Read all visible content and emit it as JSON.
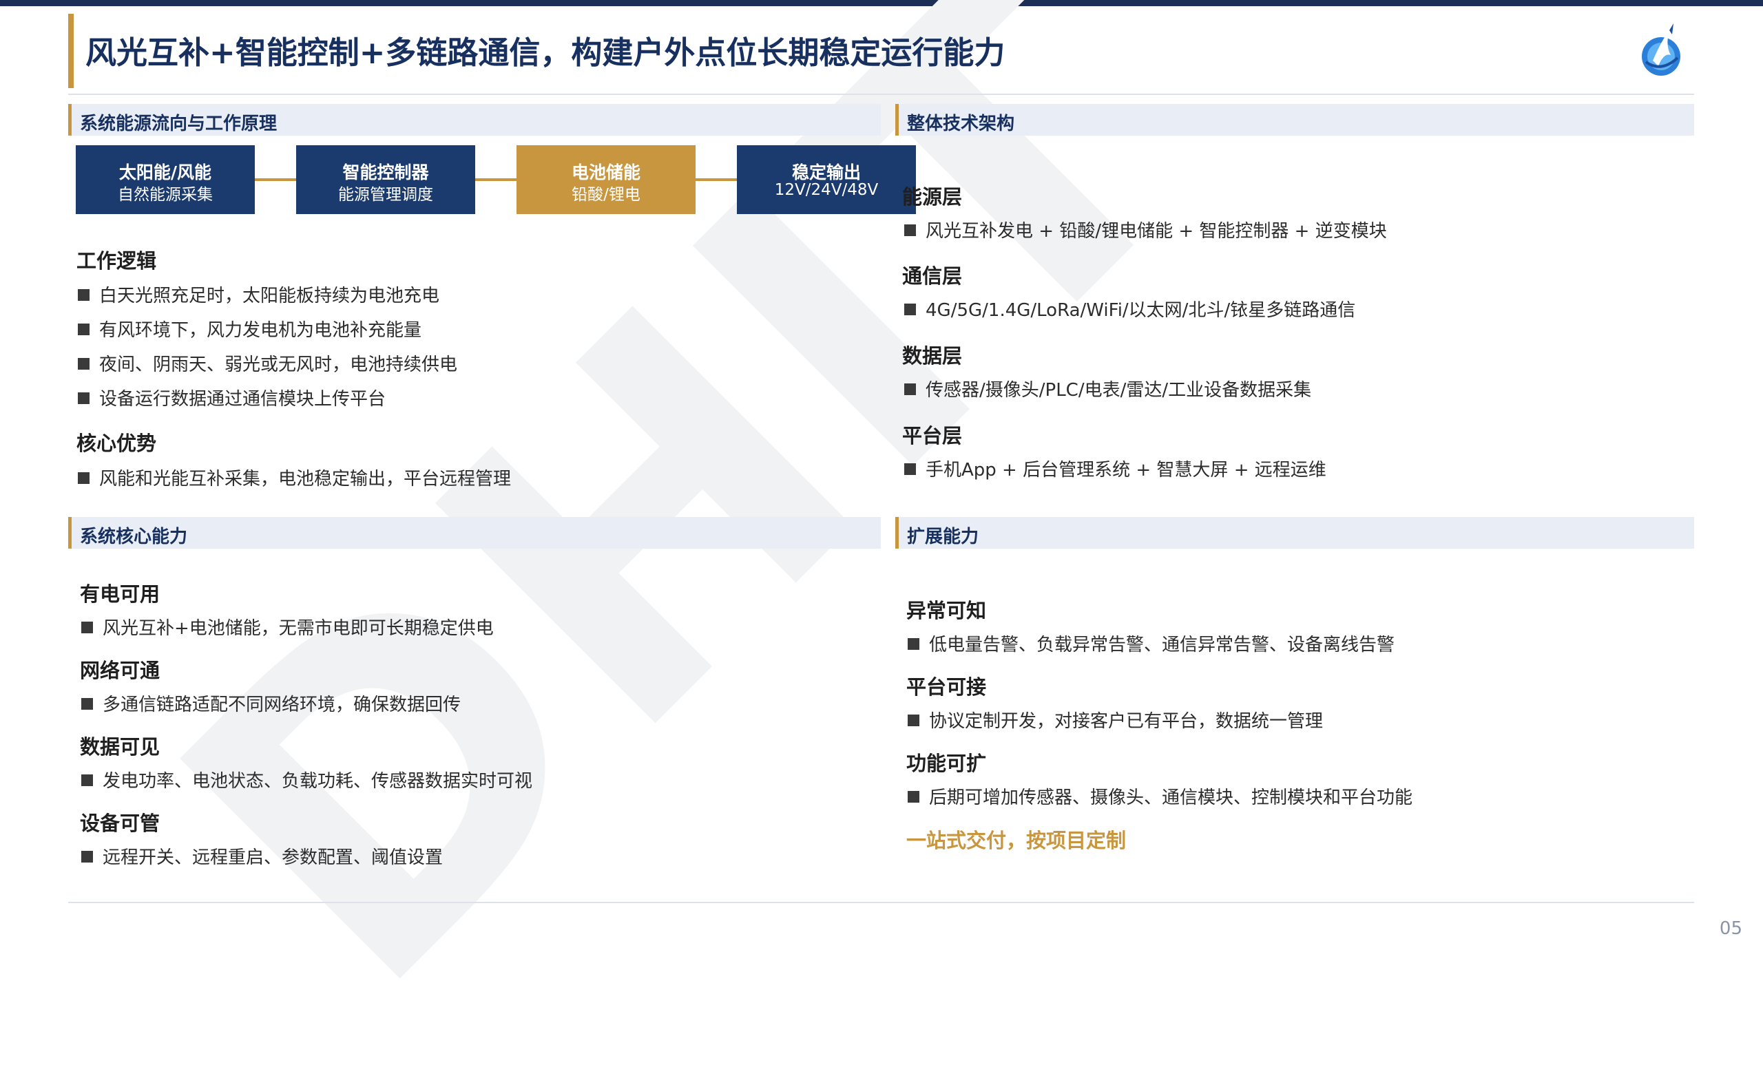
{
  "header": {
    "title": "风光互补+智能控制+多链路通信，构建户外点位长期稳定运行能力",
    "logo_icon": "company-logo-icon",
    "accent_color": "#c8963e",
    "brand_color": "#17305f"
  },
  "watermark": {
    "text": "DHIT"
  },
  "page_number": "05",
  "energy_flow": {
    "section_title": "系统能源流向与工作原理",
    "steps": [
      {
        "title": "太阳能/风能",
        "subtitle": "自然能源采集"
      },
      {
        "title": "智能控制器",
        "subtitle": "能源管理调度"
      },
      {
        "title": "电池储能",
        "subtitle": "铅酸/锂电"
      },
      {
        "title": "稳定输出",
        "subtitle": "12V/24V/48V"
      }
    ],
    "logic_heading": "工作逻辑",
    "logic_items": [
      "白天光照充足时，太阳能板持续为电池充电",
      "有风环境下，风力发电机为电池补充能量",
      "夜间、阴雨天、弱光或无风时，电池持续供电",
      "设备运行数据通过通信模块上传平台"
    ],
    "advantage_heading": "核心优势",
    "advantage_items": [
      "风能和光能互补采集，电池稳定输出，平台远程管理"
    ]
  },
  "architecture": {
    "section_title": "整体技术架构",
    "layers": [
      {
        "name": "能源层",
        "detail": "风光互补发电 + 铅酸/锂电储能 + 智能控制器 + 逆变模块"
      },
      {
        "name": "通信层",
        "detail": "4G/5G/1.4G/LoRa/WiFi/以太网/北斗/铱星多链路通信"
      },
      {
        "name": "数据层",
        "detail": "传感器/摄像头/PLC/电表/雷达/工业设备数据采集"
      },
      {
        "name": "平台层",
        "detail": "手机App + 后台管理系统 + 智慧大屏 + 远程运维"
      }
    ]
  },
  "core_capabilities": {
    "section_title": "系统核心能力",
    "items": [
      {
        "name": "有电可用",
        "detail": "风光互补+电池储能，无需市电即可长期稳定供电"
      },
      {
        "name": "网络可通",
        "detail": "多通信链路适配不同网络环境，确保数据回传"
      },
      {
        "name": "数据可见",
        "detail": "发电功率、电池状态、负载功耗、传感器数据实时可视"
      },
      {
        "name": "设备可管",
        "detail": "远程开关、远程重启、参数配置、阈值设置"
      }
    ]
  },
  "extensions": {
    "section_title": "扩展能力",
    "items": [
      {
        "name": "异常可知",
        "detail": "低电量告警、负载异常告警、通信异常告警、设备离线告警"
      },
      {
        "name": "平台可接",
        "detail": "协议定制开发，对接客户已有平台，数据统一管理"
      },
      {
        "name": "功能可扩",
        "detail": "后期可增加传感器、摄像头、通信模块、控制模块和平台功能"
      }
    ],
    "closing": "一站式交付，按项目定制"
  }
}
